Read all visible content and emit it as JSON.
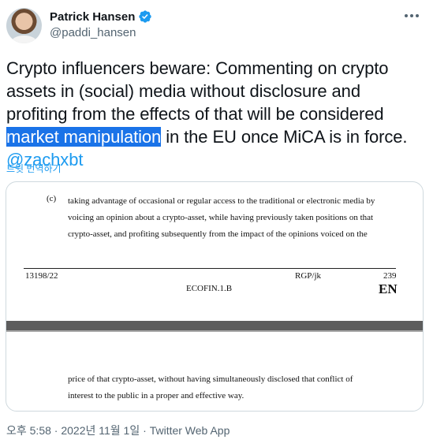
{
  "author": {
    "name": "Patrick Hansen",
    "handle": "@paddi_hansen",
    "avatar_icon": "user-avatar",
    "verified_icon": "verified-badge-icon"
  },
  "tweet": {
    "text_before_highlight": "Crypto influencers beware: Commenting on crypto assets in (social) media without disclosure and profiting from the effects of that will be considered ",
    "highlighted_text": "market manipulation",
    "text_after_highlight": " in the EU once MiCA is in force.",
    "mention": "@zachxbt",
    "translate_label": "트윗 번역하기"
  },
  "document_image": {
    "item_label": "(c)",
    "lines_top": [
      "taking advantage of occasional or regular access to the traditional or electronic media by",
      "voicing an opinion about a crypto-asset, while having previously taken positions on that",
      "crypto-asset, and profiting subsequently from the impact of the opinions voiced on the"
    ],
    "footer": {
      "doc_number": "13198/22",
      "initials": "RGP/jk",
      "page": "239",
      "department": "ECOFIN.1.B",
      "language": "EN"
    },
    "lines_bottom": [
      "price of that crypto-asset, without having simultaneously disclosed that conflict of",
      "interest to the public in a proper and effective way."
    ]
  },
  "meta": {
    "timestamp": "오후 5:58 · 2022년 11월 1일",
    "separator": " · ",
    "source": "Twitter Web App"
  },
  "colors": {
    "link": "#1d9bf0",
    "highlight": "#1a73e8",
    "text": "#0f1419",
    "secondary": "#536471"
  }
}
